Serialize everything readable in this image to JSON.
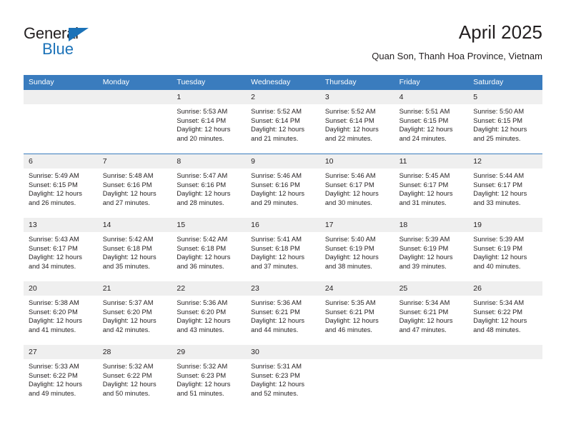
{
  "branding": {
    "word_general": "General",
    "word_blue": "Blue"
  },
  "header": {
    "title": "April 2025",
    "subtitle": "Quan Son, Thanh Hoa Province, Vietnam"
  },
  "colors": {
    "header_blue": "#3a7cbe",
    "logo_blue": "#1b72b8",
    "day_strip_gray": "#efefef",
    "text": "#231f20"
  },
  "weekdays": [
    "Sunday",
    "Monday",
    "Tuesday",
    "Wednesday",
    "Thursday",
    "Friday",
    "Saturday"
  ],
  "weeks": [
    [
      {
        "day": "",
        "sunrise": "",
        "sunset": "",
        "daylight1": "",
        "daylight2": ""
      },
      {
        "day": "",
        "sunrise": "",
        "sunset": "",
        "daylight1": "",
        "daylight2": ""
      },
      {
        "day": "1",
        "sunrise": "Sunrise: 5:53 AM",
        "sunset": "Sunset: 6:14 PM",
        "daylight1": "Daylight: 12 hours",
        "daylight2": "and 20 minutes."
      },
      {
        "day": "2",
        "sunrise": "Sunrise: 5:52 AM",
        "sunset": "Sunset: 6:14 PM",
        "daylight1": "Daylight: 12 hours",
        "daylight2": "and 21 minutes."
      },
      {
        "day": "3",
        "sunrise": "Sunrise: 5:52 AM",
        "sunset": "Sunset: 6:14 PM",
        "daylight1": "Daylight: 12 hours",
        "daylight2": "and 22 minutes."
      },
      {
        "day": "4",
        "sunrise": "Sunrise: 5:51 AM",
        "sunset": "Sunset: 6:15 PM",
        "daylight1": "Daylight: 12 hours",
        "daylight2": "and 24 minutes."
      },
      {
        "day": "5",
        "sunrise": "Sunrise: 5:50 AM",
        "sunset": "Sunset: 6:15 PM",
        "daylight1": "Daylight: 12 hours",
        "daylight2": "and 25 minutes."
      }
    ],
    [
      {
        "day": "6",
        "sunrise": "Sunrise: 5:49 AM",
        "sunset": "Sunset: 6:15 PM",
        "daylight1": "Daylight: 12 hours",
        "daylight2": "and 26 minutes."
      },
      {
        "day": "7",
        "sunrise": "Sunrise: 5:48 AM",
        "sunset": "Sunset: 6:16 PM",
        "daylight1": "Daylight: 12 hours",
        "daylight2": "and 27 minutes."
      },
      {
        "day": "8",
        "sunrise": "Sunrise: 5:47 AM",
        "sunset": "Sunset: 6:16 PM",
        "daylight1": "Daylight: 12 hours",
        "daylight2": "and 28 minutes."
      },
      {
        "day": "9",
        "sunrise": "Sunrise: 5:46 AM",
        "sunset": "Sunset: 6:16 PM",
        "daylight1": "Daylight: 12 hours",
        "daylight2": "and 29 minutes."
      },
      {
        "day": "10",
        "sunrise": "Sunrise: 5:46 AM",
        "sunset": "Sunset: 6:17 PM",
        "daylight1": "Daylight: 12 hours",
        "daylight2": "and 30 minutes."
      },
      {
        "day": "11",
        "sunrise": "Sunrise: 5:45 AM",
        "sunset": "Sunset: 6:17 PM",
        "daylight1": "Daylight: 12 hours",
        "daylight2": "and 31 minutes."
      },
      {
        "day": "12",
        "sunrise": "Sunrise: 5:44 AM",
        "sunset": "Sunset: 6:17 PM",
        "daylight1": "Daylight: 12 hours",
        "daylight2": "and 33 minutes."
      }
    ],
    [
      {
        "day": "13",
        "sunrise": "Sunrise: 5:43 AM",
        "sunset": "Sunset: 6:17 PM",
        "daylight1": "Daylight: 12 hours",
        "daylight2": "and 34 minutes."
      },
      {
        "day": "14",
        "sunrise": "Sunrise: 5:42 AM",
        "sunset": "Sunset: 6:18 PM",
        "daylight1": "Daylight: 12 hours",
        "daylight2": "and 35 minutes."
      },
      {
        "day": "15",
        "sunrise": "Sunrise: 5:42 AM",
        "sunset": "Sunset: 6:18 PM",
        "daylight1": "Daylight: 12 hours",
        "daylight2": "and 36 minutes."
      },
      {
        "day": "16",
        "sunrise": "Sunrise: 5:41 AM",
        "sunset": "Sunset: 6:18 PM",
        "daylight1": "Daylight: 12 hours",
        "daylight2": "and 37 minutes."
      },
      {
        "day": "17",
        "sunrise": "Sunrise: 5:40 AM",
        "sunset": "Sunset: 6:19 PM",
        "daylight1": "Daylight: 12 hours",
        "daylight2": "and 38 minutes."
      },
      {
        "day": "18",
        "sunrise": "Sunrise: 5:39 AM",
        "sunset": "Sunset: 6:19 PM",
        "daylight1": "Daylight: 12 hours",
        "daylight2": "and 39 minutes."
      },
      {
        "day": "19",
        "sunrise": "Sunrise: 5:39 AM",
        "sunset": "Sunset: 6:19 PM",
        "daylight1": "Daylight: 12 hours",
        "daylight2": "and 40 minutes."
      }
    ],
    [
      {
        "day": "20",
        "sunrise": "Sunrise: 5:38 AM",
        "sunset": "Sunset: 6:20 PM",
        "daylight1": "Daylight: 12 hours",
        "daylight2": "and 41 minutes."
      },
      {
        "day": "21",
        "sunrise": "Sunrise: 5:37 AM",
        "sunset": "Sunset: 6:20 PM",
        "daylight1": "Daylight: 12 hours",
        "daylight2": "and 42 minutes."
      },
      {
        "day": "22",
        "sunrise": "Sunrise: 5:36 AM",
        "sunset": "Sunset: 6:20 PM",
        "daylight1": "Daylight: 12 hours",
        "daylight2": "and 43 minutes."
      },
      {
        "day": "23",
        "sunrise": "Sunrise: 5:36 AM",
        "sunset": "Sunset: 6:21 PM",
        "daylight1": "Daylight: 12 hours",
        "daylight2": "and 44 minutes."
      },
      {
        "day": "24",
        "sunrise": "Sunrise: 5:35 AM",
        "sunset": "Sunset: 6:21 PM",
        "daylight1": "Daylight: 12 hours",
        "daylight2": "and 46 minutes."
      },
      {
        "day": "25",
        "sunrise": "Sunrise: 5:34 AM",
        "sunset": "Sunset: 6:21 PM",
        "daylight1": "Daylight: 12 hours",
        "daylight2": "and 47 minutes."
      },
      {
        "day": "26",
        "sunrise": "Sunrise: 5:34 AM",
        "sunset": "Sunset: 6:22 PM",
        "daylight1": "Daylight: 12 hours",
        "daylight2": "and 48 minutes."
      }
    ],
    [
      {
        "day": "27",
        "sunrise": "Sunrise: 5:33 AM",
        "sunset": "Sunset: 6:22 PM",
        "daylight1": "Daylight: 12 hours",
        "daylight2": "and 49 minutes."
      },
      {
        "day": "28",
        "sunrise": "Sunrise: 5:32 AM",
        "sunset": "Sunset: 6:22 PM",
        "daylight1": "Daylight: 12 hours",
        "daylight2": "and 50 minutes."
      },
      {
        "day": "29",
        "sunrise": "Sunrise: 5:32 AM",
        "sunset": "Sunset: 6:23 PM",
        "daylight1": "Daylight: 12 hours",
        "daylight2": "and 51 minutes."
      },
      {
        "day": "30",
        "sunrise": "Sunrise: 5:31 AM",
        "sunset": "Sunset: 6:23 PM",
        "daylight1": "Daylight: 12 hours",
        "daylight2": "and 52 minutes."
      },
      {
        "day": "",
        "sunrise": "",
        "sunset": "",
        "daylight1": "",
        "daylight2": ""
      },
      {
        "day": "",
        "sunrise": "",
        "sunset": "",
        "daylight1": "",
        "daylight2": ""
      },
      {
        "day": "",
        "sunrise": "",
        "sunset": "",
        "daylight1": "",
        "daylight2": ""
      }
    ]
  ]
}
